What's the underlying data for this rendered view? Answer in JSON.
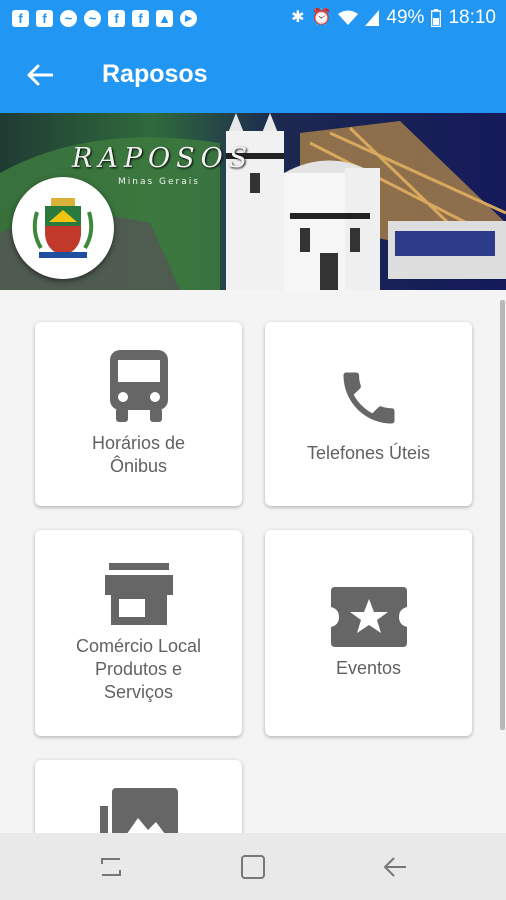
{
  "status_bar": {
    "notification_icons": [
      "facebook-icon",
      "facebook-icon",
      "messenger-icon",
      "messenger-icon",
      "facebook-icon",
      "facebook-icon",
      "gallery-icon",
      "cast-icon"
    ],
    "battery": "49%",
    "time": "18:10"
  },
  "app_bar": {
    "title": "Raposos",
    "color": "#2196f3"
  },
  "banner": {
    "title": "RAPOSOS",
    "subtitle": "Minas Gerais"
  },
  "menu": {
    "items": [
      {
        "label": "Horários de\nÔnibus",
        "icon": "bus-icon"
      },
      {
        "label": "Telefones Úteis",
        "icon": "phone-icon"
      },
      {
        "label": "Comércio Local\nProdutos e\nServiços",
        "icon": "store-icon"
      },
      {
        "label": "Eventos",
        "icon": "ticket-icon"
      },
      {
        "label": "",
        "icon": "photo-gallery-icon"
      }
    ]
  },
  "nav_bar": {
    "buttons": [
      "recent-apps",
      "home",
      "back"
    ]
  }
}
